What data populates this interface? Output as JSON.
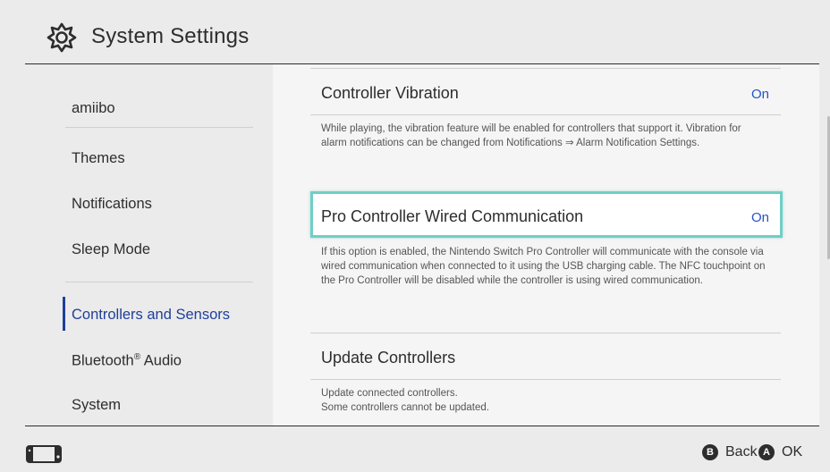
{
  "header": {
    "title": "System Settings",
    "icon": "gear-icon"
  },
  "sidebar": {
    "items": [
      {
        "label": "amiibo"
      },
      {
        "label": "Themes"
      },
      {
        "label": "Notifications"
      },
      {
        "label": "Sleep Mode"
      },
      {
        "label": "Controllers and Sensors",
        "active": true
      },
      {
        "label": "Bluetooth",
        "suffix": "®",
        "label_tail": " Audio"
      },
      {
        "label": "System"
      }
    ]
  },
  "content": {
    "options": [
      {
        "label": "Controller Vibration",
        "value": "On",
        "description": "While playing, the vibration feature will be enabled for controllers that support it. Vibration for alarm notifications can be changed from Notifications ⇒ Alarm Notification Settings."
      },
      {
        "label": "Pro Controller Wired Communication",
        "value": "On",
        "selected": true,
        "description": "If this option is enabled, the Nintendo Switch Pro Controller will communicate with the console via wired communication when connected to it using the USB charging cable. The NFC touchpoint on the Pro Controller will be disabled while the controller is using wired communication."
      },
      {
        "label": "Update Controllers",
        "description_lines": [
          "Update connected controllers.",
          "Some controllers cannot be updated."
        ]
      }
    ]
  },
  "footer": {
    "console_icon": "console-icon",
    "back": {
      "button": "B",
      "label": "Back"
    },
    "ok": {
      "button": "A",
      "label": "OK"
    }
  },
  "colors": {
    "accent_blue": "#2453c6",
    "active_nav": "#1f3f9a",
    "selection_border": "#6fcfc6"
  }
}
